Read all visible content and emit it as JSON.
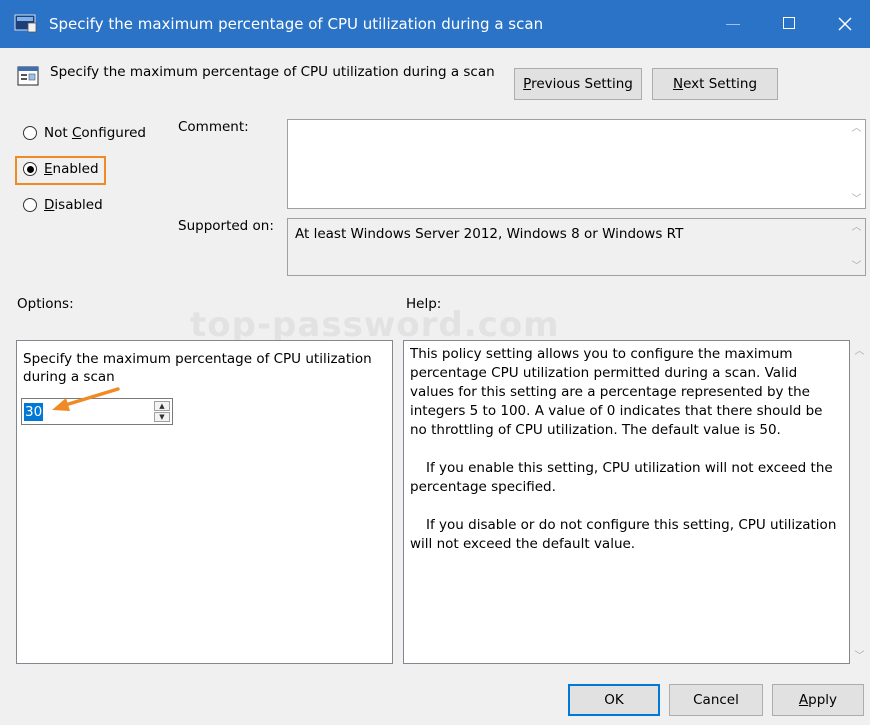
{
  "window": {
    "title": "Specify the maximum percentage of CPU utilization during a scan",
    "accent_color": "#2b73c7",
    "controls": [
      "minimize-icon",
      "maximize-icon",
      "close-icon"
    ]
  },
  "header": {
    "policy_title": "Specify the maximum percentage of CPU utilization during a scan",
    "previous_button": {
      "mnemonic": "P",
      "rest": "revious Setting"
    },
    "next_button": {
      "mnemonic": "N",
      "rest": "ext Setting"
    }
  },
  "state": {
    "not_configured": {
      "before": "Not ",
      "mnemonic": "C",
      "after": "onfigured"
    },
    "enabled": {
      "mnemonic": "E",
      "after": "nabled",
      "selected": true
    },
    "disabled": {
      "mnemonic": "D",
      "after": "isabled"
    },
    "highlight_color": "#f08a24"
  },
  "comment": {
    "label": "Comment:",
    "value": ""
  },
  "supported_on": {
    "label": "Supported on:",
    "value": "At least Windows Server 2012, Windows 8 or Windows RT"
  },
  "options": {
    "label": "Options:",
    "description": "Specify the maximum percentage of CPU utilization during a scan",
    "spinner_value": "30"
  },
  "help": {
    "label": "Help:",
    "paragraphs": [
      "This policy setting allows you to configure the maximum percentage CPU utilization permitted during a scan. Valid values for this setting are a percentage represented by the integers 5 to 100. A value of 0 indicates that there should be no throttling of CPU utilization. The default value is 50.",
      "If you enable this setting, CPU utilization will not exceed the percentage specified.",
      "If you disable or do not configure this setting, CPU utilization will not exceed the default value."
    ]
  },
  "watermark": "top-password.com",
  "footer": {
    "ok_label": "OK",
    "cancel_label": "Cancel",
    "apply_button": {
      "mnemonic": "A",
      "rest": "pply"
    }
  }
}
